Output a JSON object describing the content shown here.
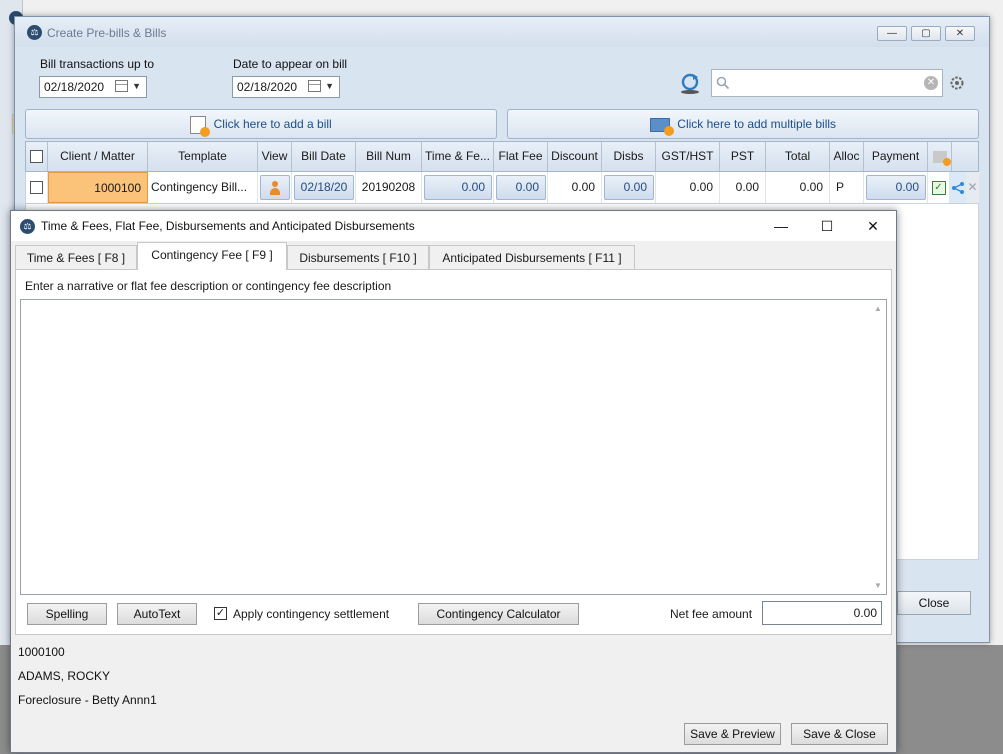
{
  "main_window": {
    "title": "Create Pre-bills & Bills",
    "controls": {
      "minimize": "—",
      "restore": "▢",
      "close": "✕"
    },
    "bill_transactions_label": "Bill transactions up to",
    "bill_transactions_value": "02/18/2020",
    "date_on_bill_label": "Date to appear on bill",
    "date_on_bill_value": "02/18/2020",
    "search_placeholder": "",
    "add_bill_label": "Click here to add a bill",
    "add_multiple_bills_label": "Click here to add multiple bills",
    "close_label": "Close",
    "grid": {
      "columns": [
        "Client / Matter",
        "Template",
        "View",
        "Bill Date",
        "Bill Num",
        "Time & Fe...",
        "Flat Fee",
        "Discount",
        "Disbs",
        "GST/HST",
        "PST",
        "Total",
        "Alloc",
        "Payment"
      ],
      "row": {
        "client_matter": "1000100",
        "template": "Contingency  Bill...",
        "bill_date": "02/18/20",
        "bill_num": "20190208",
        "time_fees": "0.00",
        "flat_fee": "0.00",
        "discount": "0.00",
        "disbs": "0.00",
        "gst_hst": "0.00",
        "pst": "0.00",
        "total": "0.00",
        "alloc": "P",
        "payment": "0.00"
      }
    }
  },
  "dialog": {
    "title": "Time & Fees, Flat Fee, Disbursements and Anticipated Disbursements",
    "controls": {
      "minimize": "—",
      "maximize": "☐",
      "close": "✕"
    },
    "tabs": [
      {
        "label": "Time & Fees [ F8 ]"
      },
      {
        "label": "Contingency Fee [ F9 ]"
      },
      {
        "label": "Disbursements [ F10 ]"
      },
      {
        "label": "Anticipated Disbursements [ F11 ]"
      }
    ],
    "active_tab": "Contingency Fee [ F9 ]",
    "narrative_prompt": "Enter a narrative or flat fee description or contingency fee description",
    "narrative_value": "",
    "spelling_label": "Spelling",
    "autotext_label": "AutoText",
    "apply_contingency_label": "Apply contingency settlement",
    "apply_contingency_checked": true,
    "calculator_label": "Contingency Calculator",
    "net_fee_label": "Net fee amount",
    "net_fee_value": "0.00",
    "footer": {
      "matter_number": "1000100",
      "client_name": "ADAMS, ROCKY",
      "matter_description": "Foreclosure - Betty Annn1"
    },
    "save_preview_label": "Save & Preview",
    "save_close_label": "Save & Close"
  }
}
